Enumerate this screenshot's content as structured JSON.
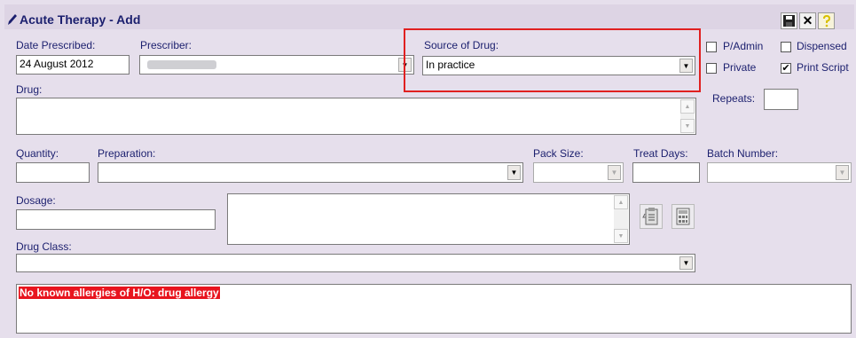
{
  "window": {
    "title": "Acute Therapy - Add"
  },
  "toolbar": {
    "save_icon": "floppy-disk-icon",
    "close_label": "✕",
    "help_icon": "help-icon"
  },
  "labels": {
    "date_prescribed": "Date Prescribed:",
    "prescriber": "Prescriber:",
    "source_of_drug": "Source of Drug:",
    "drug": "Drug:",
    "quantity": "Quantity:",
    "preparation": "Preparation:",
    "pack_size": "Pack Size:",
    "treat_days": "Treat Days:",
    "batch_number": "Batch Number:",
    "dosage": "Dosage:",
    "drug_class": "Drug Class:",
    "repeats": "Repeats:"
  },
  "values": {
    "date_prescribed": "24 August 2012",
    "source_of_drug": "In practice"
  },
  "checkboxes": [
    {
      "label": "P/Admin",
      "checked": false
    },
    {
      "label": "Dispensed",
      "checked": false
    },
    {
      "label": "Private",
      "checked": false
    },
    {
      "label": "Print Script",
      "checked": true
    }
  ],
  "allergy": {
    "text": "No known allergies of H/O: drug allergy",
    "color": "#e8141e"
  },
  "annotation": {
    "color": "#e02020"
  }
}
